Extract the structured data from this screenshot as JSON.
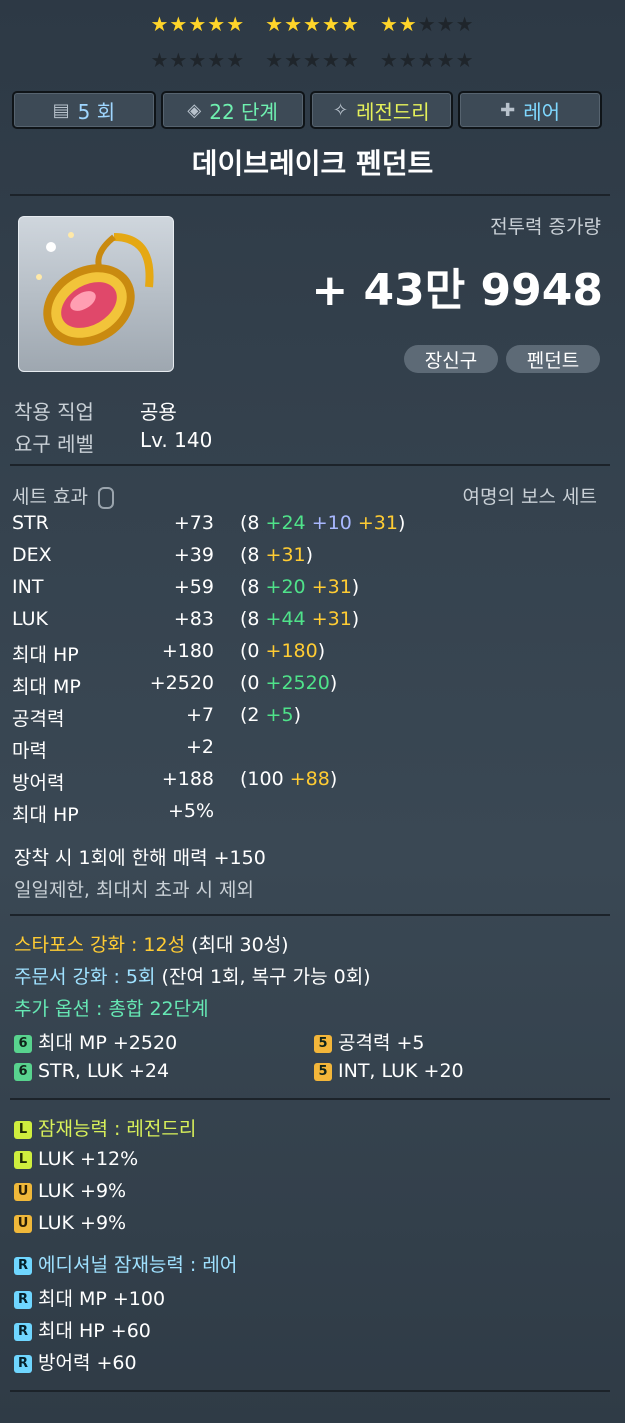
{
  "starforce": {
    "row1": [
      [
        1,
        1,
        1,
        1,
        1
      ],
      [
        1,
        1,
        1,
        1,
        1
      ],
      [
        1,
        1,
        0,
        0,
        0
      ]
    ],
    "row2": [
      [
        0,
        0,
        0,
        0,
        0
      ],
      [
        0,
        0,
        0,
        0,
        0
      ],
      [
        0,
        0,
        0,
        0,
        0
      ]
    ]
  },
  "tabs": [
    {
      "icon": "scroll-icon",
      "label": "5 회"
    },
    {
      "icon": "growth-icon",
      "label": "22 단계"
    },
    {
      "icon": "potential-icon",
      "label": "레전드리"
    },
    {
      "icon": "additional-icon",
      "label": "레어"
    }
  ],
  "item": {
    "name": "데이브레이크 펜던트",
    "cp_label": "전투력 증가량",
    "cp_value": "+ 43만 9948",
    "tags": [
      "장신구",
      "펜던트"
    ],
    "req_job_label": "착용 직업",
    "req_job_value": "공용",
    "req_level_label": "요구 레벨",
    "req_level_value": "Lv. 140"
  },
  "set": {
    "label": "세트 효과",
    "name": "여명의 보스 세트"
  },
  "stats": [
    {
      "name": "STR",
      "total": "+73",
      "open": "(8",
      "parts": [
        {
          "v": "+24",
          "c": "green"
        },
        {
          "v": "+10",
          "c": "blue"
        },
        {
          "v": "+31",
          "c": "yellow"
        }
      ],
      "close": ")"
    },
    {
      "name": "DEX",
      "total": "+39",
      "open": "(8",
      "parts": [
        {
          "v": "+31",
          "c": "yellow"
        }
      ],
      "close": ")"
    },
    {
      "name": "INT",
      "total": "+59",
      "open": "(8",
      "parts": [
        {
          "v": "+20",
          "c": "green"
        },
        {
          "v": "+31",
          "c": "yellow"
        }
      ],
      "close": ")"
    },
    {
      "name": "LUK",
      "total": "+83",
      "open": "(8",
      "parts": [
        {
          "v": "+44",
          "c": "green"
        },
        {
          "v": "+31",
          "c": "yellow"
        }
      ],
      "close": ")"
    },
    {
      "name": "최대 HP",
      "total": "+180",
      "open": "(0",
      "parts": [
        {
          "v": "+180",
          "c": "yellow"
        }
      ],
      "close": ")"
    },
    {
      "name": "최대 MP",
      "total": "+2520",
      "open": "(0",
      "parts": [
        {
          "v": "+2520",
          "c": "green"
        }
      ],
      "close": ")"
    },
    {
      "name": "공격력",
      "total": "+7",
      "open": "(2",
      "parts": [
        {
          "v": "+5",
          "c": "green"
        }
      ],
      "close": ")"
    },
    {
      "name": "마력",
      "total": "+2",
      "open": "",
      "parts": [],
      "close": ""
    },
    {
      "name": "방어력",
      "total": "+188",
      "open": "(100",
      "parts": [
        {
          "v": "+88",
          "c": "yellow"
        }
      ],
      "close": ")"
    },
    {
      "name": "최대 HP",
      "total": "+5%",
      "open": "",
      "parts": [],
      "close": ""
    }
  ],
  "notes": {
    "charm": "장착 시 1회에 한해 매력 +150",
    "limit": "일일제한, 최대치 초과 시 제외"
  },
  "enhance": {
    "starforce": "스타포스 강화 : 12성",
    "starforce_max": "(최대 30성)",
    "scroll": "주문서 강화 : 5회",
    "scroll_detail": "(잔여 1회, 복구 가능 0회)",
    "flame": "추가 옵션 : 총합 22단계",
    "flame_opts": [
      {
        "grade": "6",
        "text": "최대 MP  +2520"
      },
      {
        "grade": "5",
        "text": "공격력  +5"
      },
      {
        "grade": "6",
        "text": "STR, LUK  +24"
      },
      {
        "grade": "5",
        "text": "INT, LUK  +20"
      }
    ]
  },
  "potential": {
    "title": "잠재능력 : 레전드리",
    "lines": [
      {
        "grade": "L",
        "text": "LUK +12%"
      },
      {
        "grade": "U",
        "text": "LUK +9%"
      },
      {
        "grade": "U",
        "text": "LUK +9%"
      }
    ]
  },
  "additional": {
    "title": "에디셔널 잠재능력 : 레어",
    "lines": [
      {
        "grade": "R",
        "text": "최대 MP +100"
      },
      {
        "grade": "R",
        "text": "최대 HP +60"
      },
      {
        "grade": "R",
        "text": "방어력 +60"
      }
    ]
  }
}
